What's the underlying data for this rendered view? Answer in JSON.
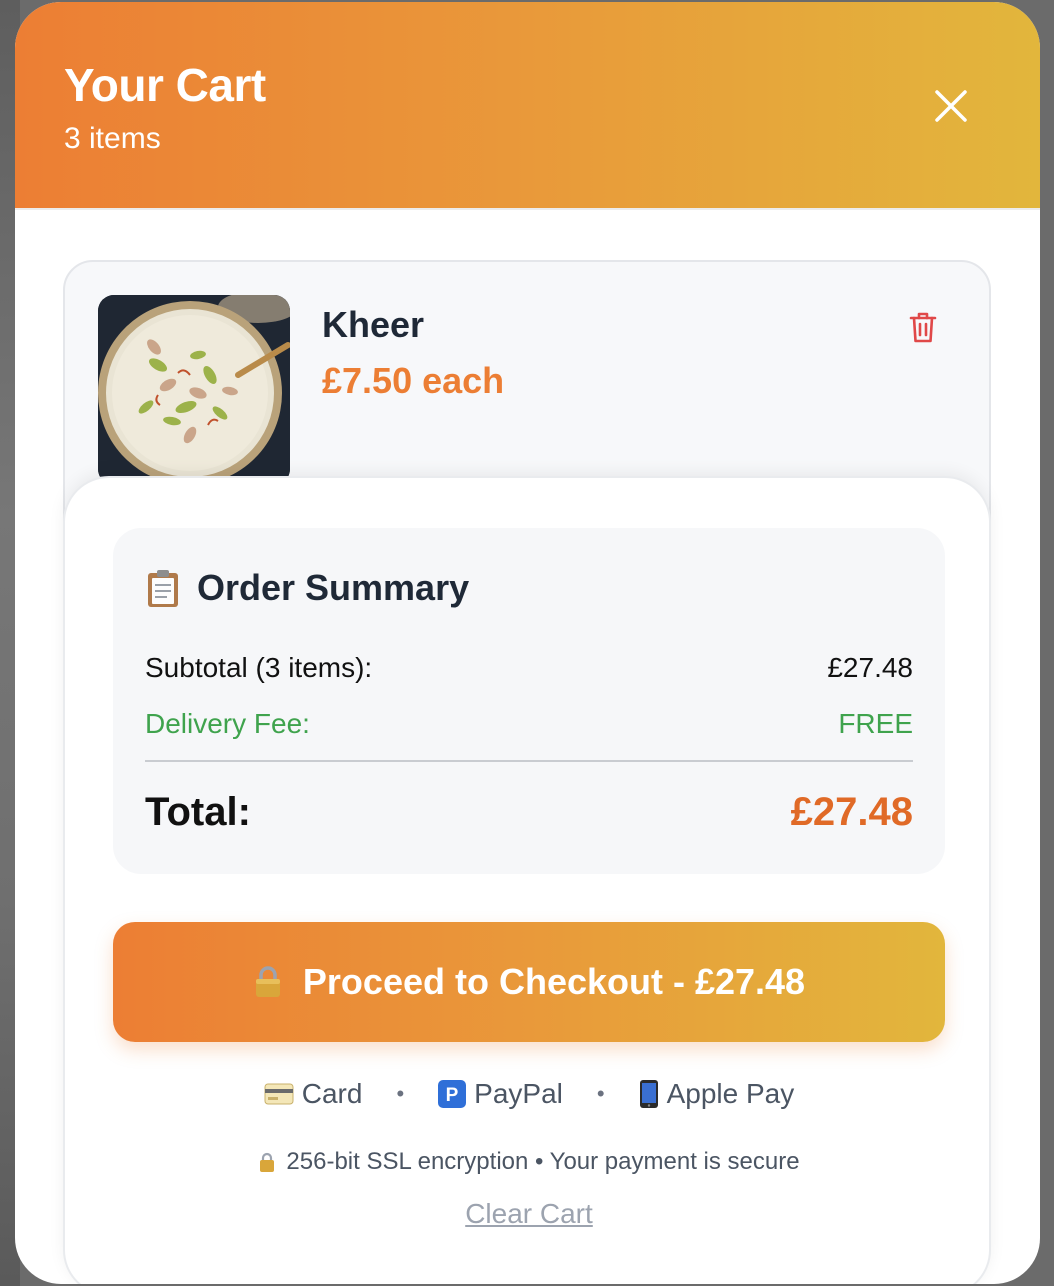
{
  "header": {
    "title": "Your Cart",
    "item_count": "3 items"
  },
  "cart_items": [
    {
      "name": "Kheer",
      "price": "£7.50 each"
    }
  ],
  "summary": {
    "heading": "Order Summary",
    "subtotal_label": "Subtotal (3 items):",
    "subtotal_value": "£27.48",
    "delivery_label": "Delivery Fee:",
    "delivery_value": "FREE",
    "total_label": "Total:",
    "total_value": "£27.48"
  },
  "checkout": {
    "label": "Proceed to Checkout - £27.48"
  },
  "payment_methods": [
    {
      "icon": "credit-card-icon",
      "label": "Card"
    },
    {
      "icon": "paypal-icon",
      "label": "PayPal"
    },
    {
      "icon": "mobile-phone-icon",
      "label": "Apple Pay"
    }
  ],
  "separator": "•",
  "security_note": "256-bit SSL encryption • Your payment is secure",
  "clear_cart_label": "Clear Cart",
  "colors": {
    "accent_orange": "#ec7e34",
    "accent_gold": "#e2b63c",
    "delivery_green": "#3fa34d",
    "total_red": "#e06a27",
    "trash_red": "#e04848"
  }
}
